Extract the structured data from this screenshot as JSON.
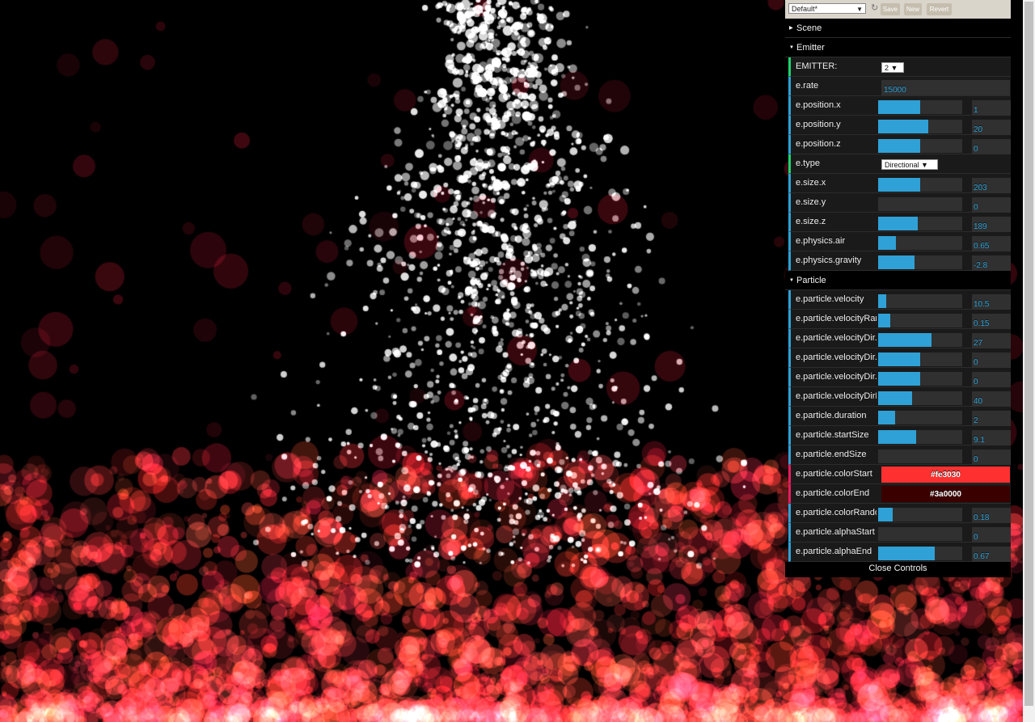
{
  "colors": {
    "accent": "#2fa1d6",
    "select_accent": "#1ed36f",
    "color_accent": "#e61d5f",
    "panel_bg": "#1a1a1a"
  },
  "save_bar": {
    "preset": "Default*",
    "gear_icon": "↻",
    "save": "Save",
    "new": "New",
    "revert": "Revert"
  },
  "folders": {
    "scene": "Scene",
    "emitter": "Emitter",
    "particle": "Particle"
  },
  "emitter": {
    "emitter_label": "EMITTER:",
    "emitter_value": "2",
    "rate_label": "e.rate",
    "rate_value": "15000",
    "pos_x_label": "e.position.x",
    "pos_x_value": "1",
    "pos_x_level": 0.5,
    "pos_y_label": "e.position.y",
    "pos_y_value": "20",
    "pos_y_level": 0.6,
    "pos_z_label": "e.position.z",
    "pos_z_value": "0",
    "pos_z_level": 0.5,
    "type_label": "e.type",
    "type_value": "Directional",
    "size_x_label": "e.size.x",
    "size_x_value": "203",
    "size_x_level": 0.5,
    "size_y_label": "e.size.y",
    "size_y_value": "0",
    "size_y_level": 0,
    "size_z_label": "e.size.z",
    "size_z_value": "189",
    "size_z_level": 0.47,
    "air_label": "e.physics.air",
    "air_value": "0.65",
    "air_level": 0.21,
    "gravity_label": "e.physics.gravity",
    "gravity_value": "-2.8",
    "gravity_level": 0.43
  },
  "particle": {
    "velocity_label": "e.particle.velocity",
    "velocity_value": "10.5",
    "velocity_level": 0.1,
    "velrand_label": "e.particle.velocityRan...",
    "velrand_value": "0.15",
    "velrand_level": 0.14,
    "veldirx_label": "e.particle.velocityDir.x",
    "veldirx_value": "27",
    "veldirx_level": 0.63,
    "veldiry_label": "e.particle.velocityDir.y",
    "veldiry_value": "0",
    "veldiry_level": 0.5,
    "veldirz_label": "e.particle.velocityDir.z",
    "veldirz_value": "0",
    "veldirz_level": 0.5,
    "veldirr_label": "e.particle.velocityDirR...",
    "veldirr_value": "40",
    "veldirr_level": 0.4,
    "duration_label": "e.particle.duration",
    "duration_value": "2",
    "duration_level": 0.2,
    "startsize_label": "e.particle.startSize",
    "startsize_value": "9.1",
    "startsize_level": 0.45,
    "endsize_label": "e.particle.endSize",
    "endsize_value": "0",
    "endsize_level": 0,
    "colorstart_label": "e.particle.colorStart",
    "colorstart_value": "#fe3030",
    "colorend_label": "e.particle.colorEnd",
    "colorend_value": "#3a0000",
    "colorrand_label": "e.particle.colorRandom",
    "colorrand_value": "0.18",
    "colorrand_level": 0.17,
    "alphastart_label": "e.particle.alphaStart",
    "alphastart_value": "0",
    "alphastart_level": 0,
    "alphaend_label": "e.particle.alphaEnd",
    "alphaend_value": "0.67",
    "alphaend_level": 0.67
  },
  "close_label": "Close Controls"
}
